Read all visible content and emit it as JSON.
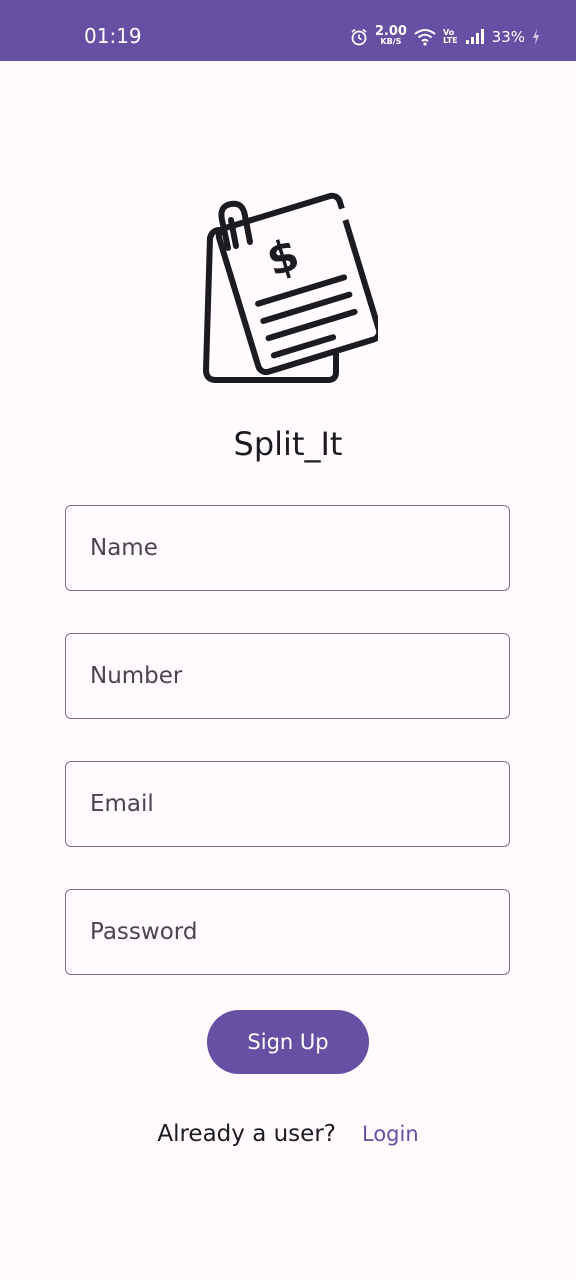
{
  "status_bar": {
    "time": "01:19",
    "net_speed_value": "2.00",
    "net_speed_unit": "KB/S",
    "volte_top": "Vo",
    "volte_bottom": "LTE",
    "battery": "33%",
    "background": "#6750a4"
  },
  "app": {
    "title": "Split_It",
    "logo_icon": "invoice-document-dollar-icon"
  },
  "form": {
    "name_placeholder": "Name",
    "number_placeholder": "Number",
    "email_placeholder": "Email",
    "password_placeholder": "Password",
    "signup_label": "Sign Up"
  },
  "footer": {
    "prompt": "Already a user?",
    "login_label": "Login"
  },
  "colors": {
    "primary": "#6750a4",
    "background": "#fffbfe",
    "outline": "#79747e",
    "text": "#1c1b1f"
  }
}
